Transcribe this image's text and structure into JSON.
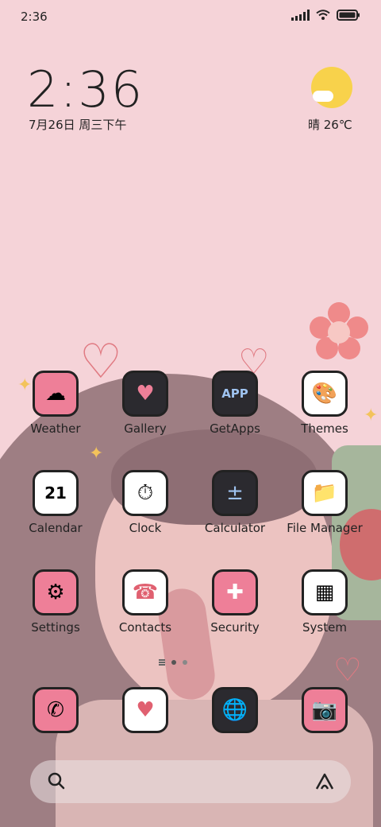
{
  "status_bar": {
    "time": "2:36",
    "icons": [
      "signal-icon",
      "wifi-icon",
      "battery-icon"
    ]
  },
  "clock_widget": {
    "time": "2:36",
    "date": "7月26日 周三下午"
  },
  "weather_widget": {
    "text": "晴 26℃",
    "icon": "sun-cloud-icon"
  },
  "apps": [
    {
      "label": "Weather",
      "icon": "cloud-rain-icon",
      "glyph": "☁"
    },
    {
      "label": "Gallery",
      "icon": "gallery-hearts-icon",
      "glyph": "♥"
    },
    {
      "label": "GetApps",
      "icon": "app-store-icon",
      "glyph": "APP"
    },
    {
      "label": "Themes",
      "icon": "palette-icon",
      "glyph": "🎨"
    },
    {
      "label": "Calendar",
      "icon": "calendar-icon",
      "glyph": "21"
    },
    {
      "label": "Clock",
      "icon": "clock-icon",
      "glyph": "⏱"
    },
    {
      "label": "Calculator",
      "icon": "calculator-icon",
      "glyph": "±"
    },
    {
      "label": "File Manager",
      "icon": "folder-icon",
      "glyph": "📁"
    },
    {
      "label": "Settings",
      "icon": "settings-icon",
      "glyph": "⚙"
    },
    {
      "label": "Contacts",
      "icon": "contacts-book-icon",
      "glyph": "☎"
    },
    {
      "label": "Security",
      "icon": "shield-icon",
      "glyph": "✚"
    },
    {
      "label": "System",
      "icon": "system-folder-icon",
      "glyph": "▦"
    }
  ],
  "page_indicator": {
    "pages": 2,
    "current": 1
  },
  "dock": [
    {
      "icon": "phone-icon",
      "glyph": "✆"
    },
    {
      "icon": "message-heart-icon",
      "glyph": "♥"
    },
    {
      "icon": "browser-globe-icon",
      "glyph": "🌐"
    },
    {
      "icon": "camera-icon",
      "glyph": "📷"
    }
  ],
  "search_bar": {
    "left_icon": "search-icon",
    "right_icon": "assistant-icon"
  },
  "colors": {
    "background": "#f5d3d8",
    "pink_icon": "#ee7f98",
    "dark_icon": "#2b2a2f",
    "sun": "#f8d24b"
  }
}
